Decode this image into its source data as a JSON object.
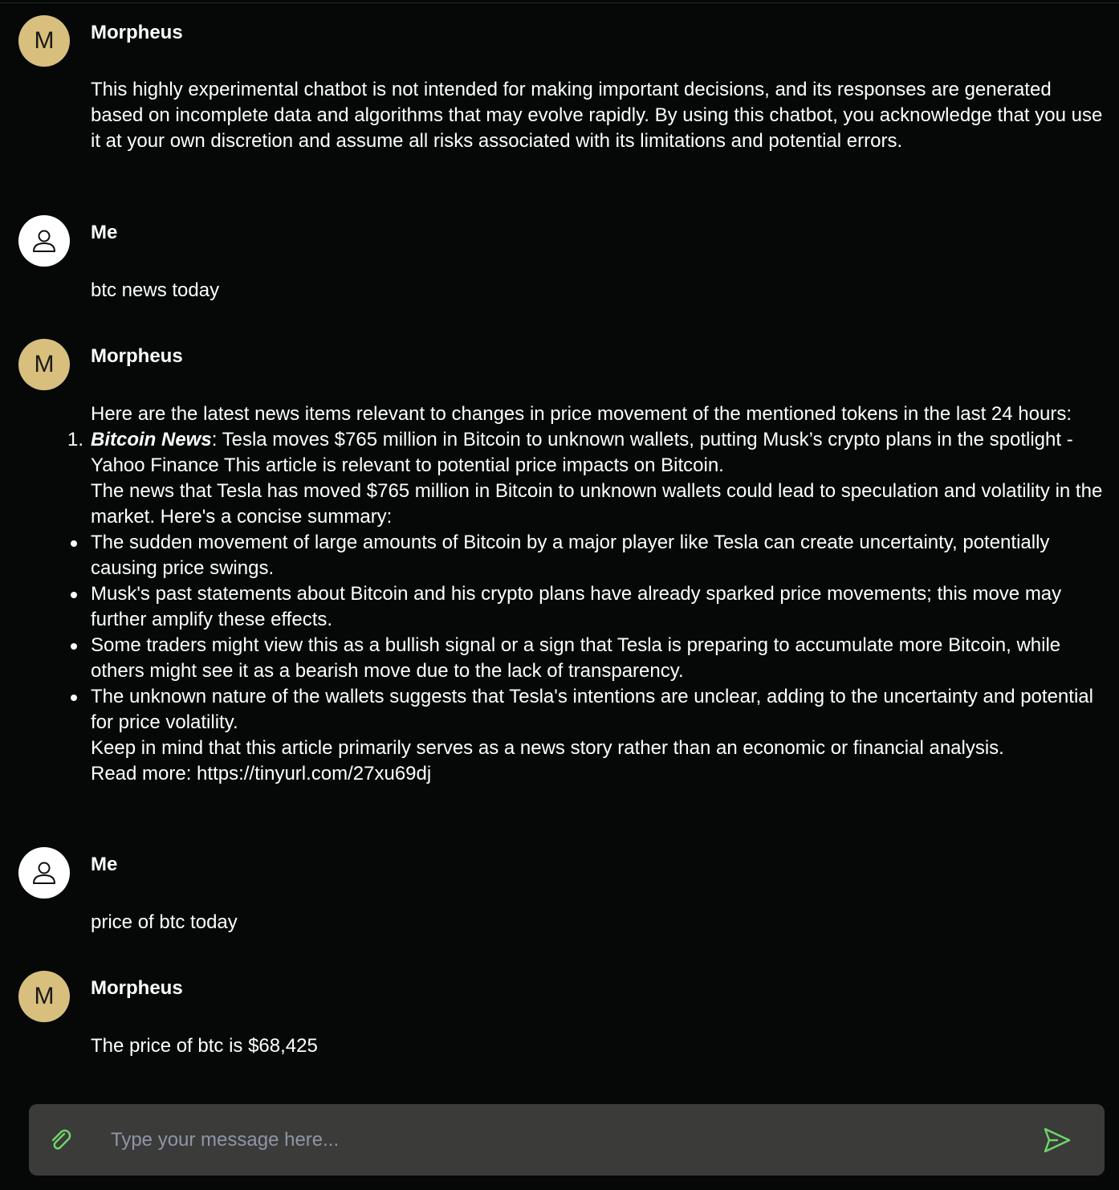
{
  "messages": [
    {
      "sender": "Morpheus",
      "avatar_letter": "M",
      "text": "This highly experimental chatbot is not intended for making important decisions, and its responses are generated based on incomplete data and algorithms that may evolve rapidly. By using this chatbot, you acknowledge that you use it at your own discretion and assume all risks associated with its limitations and potential errors."
    },
    {
      "sender": "Me",
      "avatar_icon": "user-icon",
      "text": "btc news today"
    },
    {
      "sender": "Morpheus",
      "avatar_letter": "M",
      "intro": "Here are the latest news items relevant to changes in price movement of the mentioned tokens in the last 24 hours:",
      "news": {
        "number": "1.",
        "title": "Bitcoin News",
        "headline": ": Tesla moves $765 million in Bitcoin to unknown wallets, putting Musk’s crypto plans in the spotlight - Yahoo Finance This article is relevant to potential price impacts on Bitcoin.",
        "summary": "The news that Tesla has moved $765 million in Bitcoin to unknown wallets could lead to speculation and volatility in the market. Here's a concise summary:"
      },
      "bullets": [
        "The sudden movement of large amounts of Bitcoin by a major player like Tesla can create uncertainty, potentially causing price swings.",
        "Musk's past statements about Bitcoin and his crypto plans have already sparked price movements; this move may further amplify these effects.",
        "Some traders might view this as a bullish signal or a sign that Tesla is preparing to accumulate more Bitcoin, while others might see it as a bearish move due to the lack of transparency.",
        "The unknown nature of the wallets suggests that Tesla's intentions are unclear, adding to the uncertainty and potential for price volatility."
      ],
      "footer": "Keep in mind that this article primarily serves as a news story rather than an economic or financial analysis.",
      "read_more": "Read more: https://tinyurl.com/27xu69dj"
    },
    {
      "sender": "Me",
      "avatar_icon": "user-icon",
      "text": "price of btc today"
    },
    {
      "sender": "Morpheus",
      "avatar_letter": "M",
      "text": "The price of btc is $68,425"
    }
  ],
  "composer": {
    "placeholder": "Type your message here...",
    "attach_icon": "paperclip-icon",
    "send_icon": "send-icon"
  },
  "colors": {
    "background": "#050807",
    "bot_avatar": "#d8bf7e",
    "composer_bg": "#3b3b3a",
    "accent_icon": "#6fd66a",
    "placeholder": "#8e96a5"
  }
}
